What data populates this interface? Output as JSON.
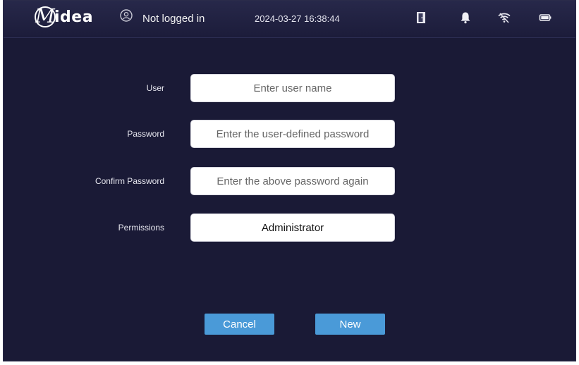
{
  "header": {
    "brand": "Midea",
    "brand_mark": "M",
    "brand_rest": "idea",
    "login_status": "Not logged in",
    "datetime": "2024-03-27 16:38:44",
    "icons": [
      "user-icon",
      "door-icon",
      "bell-icon",
      "wifi-icon",
      "battery-icon"
    ]
  },
  "form": {
    "user": {
      "label": "User",
      "placeholder": "Enter user name"
    },
    "password": {
      "label": "Password",
      "placeholder": "Enter the user-defined password"
    },
    "confirm_password": {
      "label": "Confirm Password",
      "placeholder": "Enter the above password again"
    },
    "permissions": {
      "label": "Permissions",
      "value": "Administrator"
    }
  },
  "actions": {
    "cancel_label": "Cancel",
    "new_label": "New"
  },
  "colors": {
    "background": "#1a1a36",
    "button": "#4a9ad8"
  }
}
